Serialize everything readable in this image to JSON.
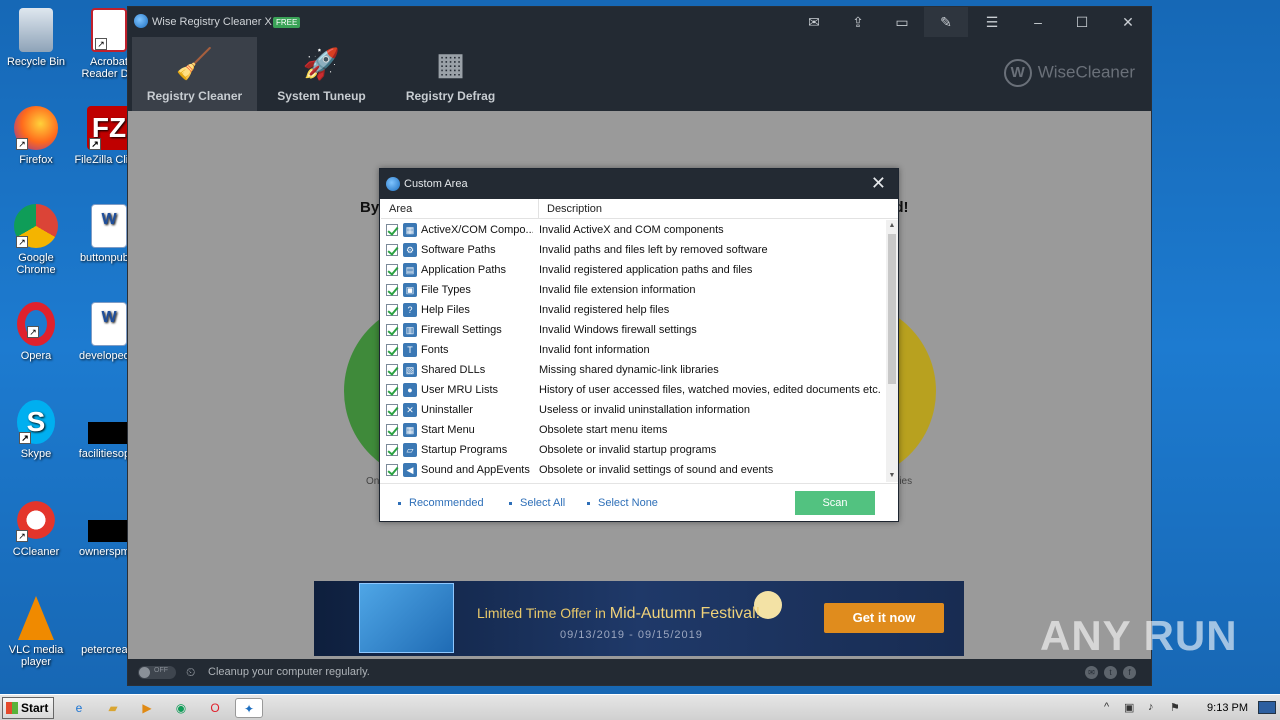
{
  "desktop": {
    "icons": [
      {
        "label": "Recycle Bin"
      },
      {
        "label": "Acrobat Reader DC"
      },
      {
        "label": "Firefox"
      },
      {
        "label": "FileZilla Client"
      },
      {
        "label": "Google Chrome"
      },
      {
        "label": "buttonpub..."
      },
      {
        "label": "Opera"
      },
      {
        "label": "developed..."
      },
      {
        "label": "Skype"
      },
      {
        "label": "facilitiesop..."
      },
      {
        "label": "CCleaner"
      },
      {
        "label": "ownerspm..."
      },
      {
        "label": "VLC media player"
      },
      {
        "label": "petercrea..."
      }
    ]
  },
  "app": {
    "title": "Wise Registry Cleaner X",
    "badge": "FREE",
    "tabs": [
      {
        "label": "Registry Cleaner"
      },
      {
        "label": "System Tuneup"
      },
      {
        "label": "Registry Defrag"
      }
    ],
    "brand": "WiseCleaner",
    "bg_heading_left": "By",
    "bg_heading_right": "ed!",
    "bg_small_left": "On",
    "bg_small_right": "ries",
    "banner": {
      "title_prefix": "Limited Time Offer in",
      "title_highlight": "Mid-Autumn Festival!",
      "dates": "09/13/2019 - 09/15/2019",
      "button": "Get it now"
    },
    "status": {
      "toggle": "OFF",
      "text": "Cleanup your computer regularly."
    }
  },
  "modal": {
    "title": "Custom Area",
    "columns": {
      "area": "Area",
      "description": "Description"
    },
    "rows": [
      {
        "area": "ActiveX/COM Compo...",
        "description": "Invalid ActiveX and COM components",
        "icon": "activex-icon"
      },
      {
        "area": "Software Paths",
        "description": "Invalid paths and files left by removed software",
        "icon": "software-paths-icon"
      },
      {
        "area": "Application Paths",
        "description": "Invalid registered application paths and files",
        "icon": "application-paths-icon"
      },
      {
        "area": "File Types",
        "description": "Invalid file extension information",
        "icon": "file-types-icon"
      },
      {
        "area": "Help Files",
        "description": "Invalid registered help files",
        "icon": "help-files-icon"
      },
      {
        "area": "Firewall Settings",
        "description": "Invalid Windows firewall settings",
        "icon": "firewall-icon"
      },
      {
        "area": "Fonts",
        "description": "Invalid font information",
        "icon": "fonts-icon"
      },
      {
        "area": "Shared DLLs",
        "description": "Missing shared dynamic-link libraries",
        "icon": "dll-icon"
      },
      {
        "area": "User MRU Lists",
        "description": "History of user accessed files, watched movies, edited documents etc.",
        "icon": "mru-icon"
      },
      {
        "area": "Uninstaller",
        "description": "Useless or invalid uninstallation information",
        "icon": "uninstaller-icon"
      },
      {
        "area": "Start Menu",
        "description": "Obsolete start menu items",
        "icon": "start-menu-icon"
      },
      {
        "area": "Startup Programs",
        "description": "Obsolete or invalid startup programs",
        "icon": "startup-icon"
      },
      {
        "area": "Sound and AppEvents",
        "description": "Obsolete or invalid settings of sound and events",
        "icon": "sound-icon"
      }
    ],
    "footer": {
      "recommended": "Recommended",
      "select_all": "Select All",
      "select_none": "Select None",
      "scan": "Scan"
    }
  },
  "taskbar": {
    "start": "Start",
    "clock": "9:13 PM"
  },
  "watermark": "ANY RUN",
  "colors": {
    "accent_green": "#52c280",
    "link_blue": "#2e6fb8",
    "titlebar": "#232a33"
  }
}
